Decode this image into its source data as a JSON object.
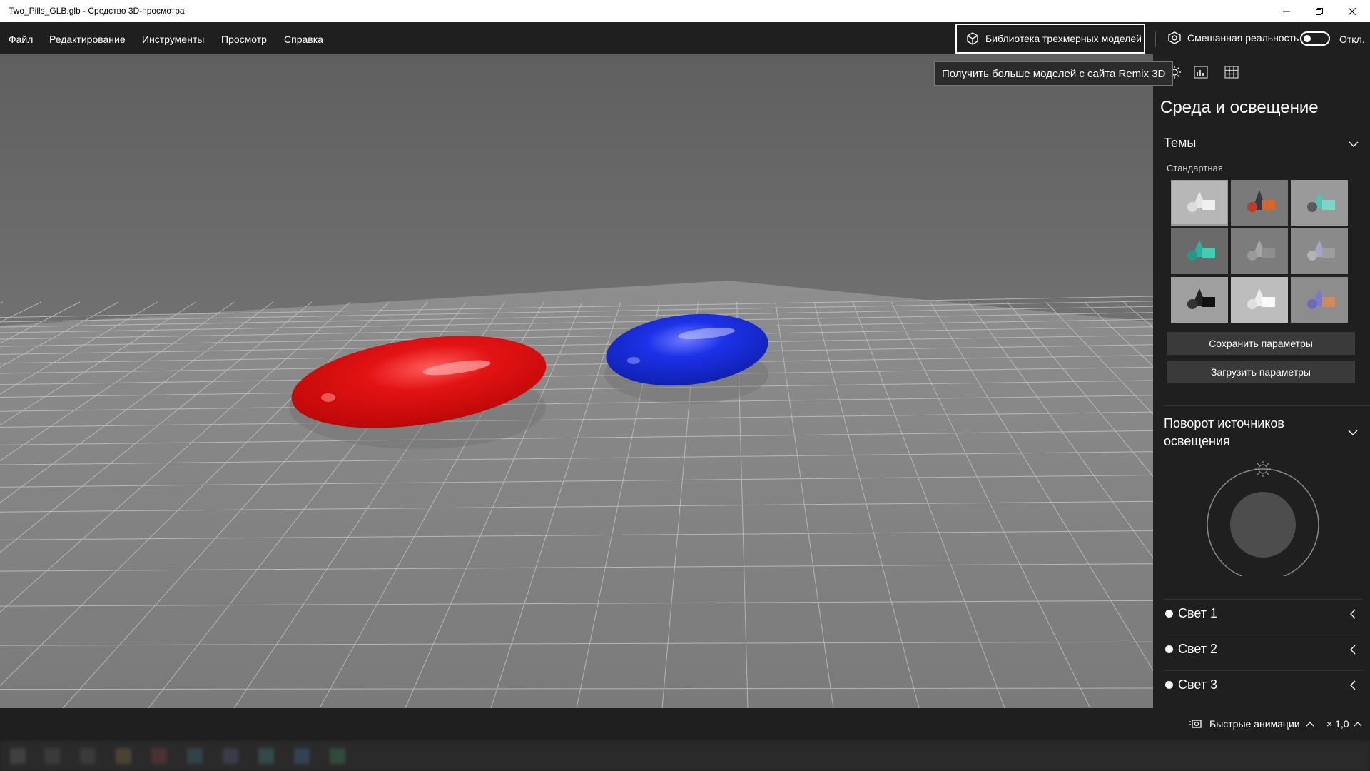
{
  "window": {
    "title": "Two_Pills_GLB.glb - Средство 3D-просмотра"
  },
  "menu": [
    "Файл",
    "Редактирование",
    "Инструменты",
    "Просмотр",
    "Справка"
  ],
  "library_button": {
    "label": "Библиотека трехмерных моделей",
    "icon": "cube-icon"
  },
  "tooltip": "Получить больше моделей с сайта Remix 3D",
  "mixed_reality": {
    "label": "Смешанная реальность",
    "state_label": "Откл.",
    "on": false
  },
  "panel": {
    "title": "Среда и освещение",
    "themes": {
      "header": "Темы",
      "group_label": "Стандартная",
      "selected_index": 0,
      "save_button": "Сохранить параметры",
      "load_button": "Загрузить параметры"
    },
    "rotation": {
      "header_line1": "Поворот источников",
      "header_line2": "освещения"
    },
    "lights": [
      "Свет 1",
      "Свет 2",
      "Свет 3"
    ]
  },
  "status": {
    "animations_label": "Быстрые анимации",
    "speed_label": "× 1,0"
  },
  "colors": {
    "background": "#1f1f1f",
    "pill_red": "#d80d0d",
    "pill_blue": "#1a2fe0",
    "button": "#3a3a3a"
  }
}
